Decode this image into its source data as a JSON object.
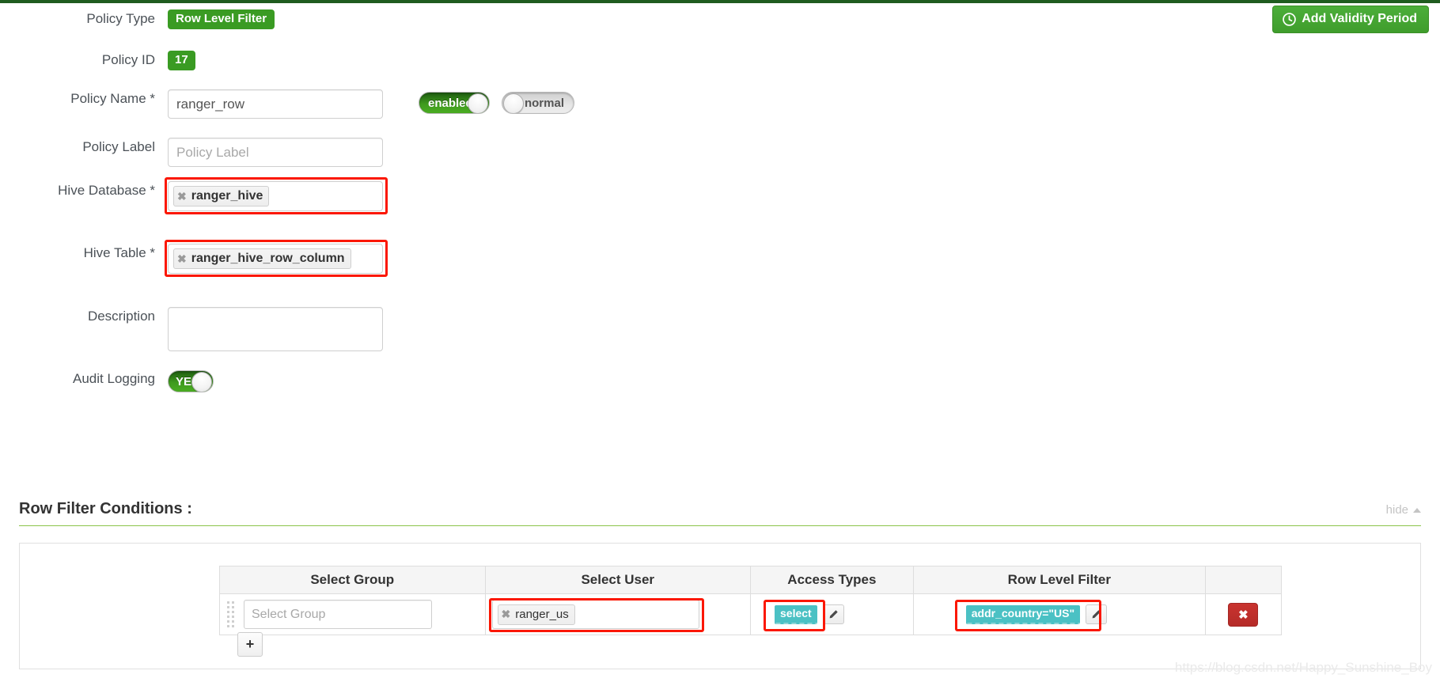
{
  "header": {
    "add_validity_label": "Add Validity Period",
    "clock_icon": "clock-icon"
  },
  "form": {
    "policy_type": {
      "label": "Policy Type",
      "value": "Row Level Filter"
    },
    "policy_id": {
      "label": "Policy ID",
      "value": "17"
    },
    "policy_name": {
      "label": "Policy Name *",
      "value": "ranger_row",
      "placeholder": "Policy Name"
    },
    "policy_label": {
      "label": "Policy Label",
      "value": "",
      "placeholder": "Policy Label"
    },
    "hive_database": {
      "label": "Hive Database *",
      "token": "ranger_hive",
      "remove_icon": "remove-icon"
    },
    "hive_table": {
      "label": "Hive Table *",
      "token": "ranger_hive_row_column",
      "remove_icon": "remove-icon"
    },
    "description": {
      "label": "Description",
      "value": "",
      "placeholder": ""
    },
    "audit_logging": {
      "label": "Audit Logging",
      "value": "YES"
    },
    "status_toggle": {
      "value": "enabled"
    },
    "normal_toggle": {
      "value": "normal"
    }
  },
  "section": {
    "title": "Row Filter Conditions :",
    "hide_label": "hide",
    "caret_icon": "caret-up-icon"
  },
  "conditions": {
    "columns": [
      "Select Group",
      "Select User",
      "Access Types",
      "Row Level Filter",
      ""
    ],
    "rows": [
      {
        "drag_handle": "drag-handle-icon",
        "select_group_placeholder": "Select Group",
        "select_user_token": "ranger_us",
        "select_user_remove_icon": "remove-icon",
        "access_types": "select",
        "access_edit_icon": "pencil-icon",
        "row_level_filter": "addr_country=\"US\"",
        "filter_edit_icon": "pencil-icon",
        "delete_label": "✖"
      }
    ],
    "add_row_label": "+"
  },
  "watermark": "https://blog.csdn.net/Happy_Sunshine_Boy"
}
